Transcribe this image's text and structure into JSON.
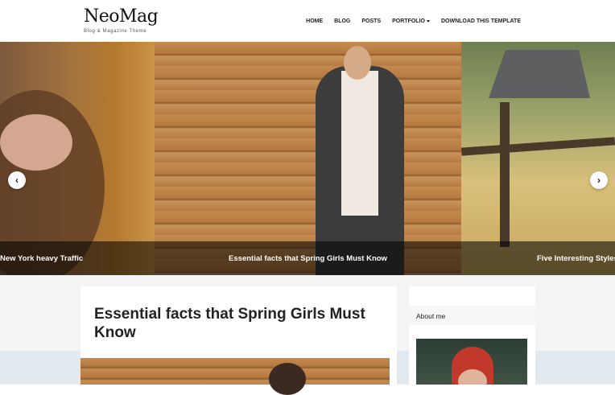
{
  "header": {
    "logo_title": "NeoMag",
    "logo_tagline": "Blog & Magazine Theme"
  },
  "nav": {
    "items": [
      {
        "label": "HOME"
      },
      {
        "label": "BLOG"
      },
      {
        "label": "POSTS"
      },
      {
        "label": "PORTFOLIO",
        "has_dropdown": true
      },
      {
        "label": "DOWNLOAD THIS TEMPLATE"
      }
    ]
  },
  "slider": {
    "slides": [
      {
        "caption": "New York heavy Traffic"
      },
      {
        "caption": "Essential facts that Spring Girls Must Know"
      },
      {
        "caption": "Five Interesting Styles T"
      }
    ],
    "prev_icon": "chevron-left-icon",
    "next_icon": "chevron-right-icon",
    "prev_glyph": "‹",
    "next_glyph": "›"
  },
  "post": {
    "title": "Essential facts that Spring Girls Must Know"
  },
  "sidebar": {
    "widget_title": "About me"
  },
  "colors": {
    "caption_bg": "#00000088",
    "page_bg": "#f4f4f4",
    "footer_band": "#e3eaef"
  }
}
